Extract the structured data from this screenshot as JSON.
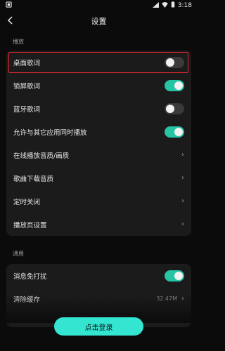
{
  "status_bar": {
    "time": "3:18",
    "icons": [
      "notification-icon",
      "signal-icon",
      "wifi-icon",
      "battery-icon"
    ]
  },
  "nav": {
    "title": "设置",
    "back_icon": "back-arrow-icon"
  },
  "sections": [
    {
      "header": "播放",
      "items": [
        {
          "label": "桌面歌词",
          "control": "toggle",
          "on": false,
          "highlighted": true
        },
        {
          "label": "锁屏歌词",
          "control": "toggle",
          "on": true
        },
        {
          "label": "蓝牙歌词",
          "control": "toggle",
          "on": false
        },
        {
          "label": "允许与其它应用同时播放",
          "control": "toggle",
          "on": true
        },
        {
          "label": "在线播放音质/画质",
          "control": "chevron"
        },
        {
          "label": "歌曲下载音质",
          "control": "chevron"
        },
        {
          "label": "定时关闭",
          "control": "chevron"
        },
        {
          "label": "播放页设置",
          "control": "chevron"
        }
      ]
    },
    {
      "header": "通用",
      "items": [
        {
          "label": "消息免打扰",
          "control": "toggle",
          "on": true
        },
        {
          "label": "清除缓存",
          "control": "chevron",
          "value": "32.47M"
        }
      ]
    }
  ],
  "login_button": {
    "label": "点击登录"
  },
  "colors": {
    "background": "#0b0b0b",
    "card": "#1b1b1b",
    "toggle_on": "#27c3a5",
    "toggle_off": "#3a3a3a",
    "login": "#34e6d1",
    "highlight": "#e3262f"
  }
}
